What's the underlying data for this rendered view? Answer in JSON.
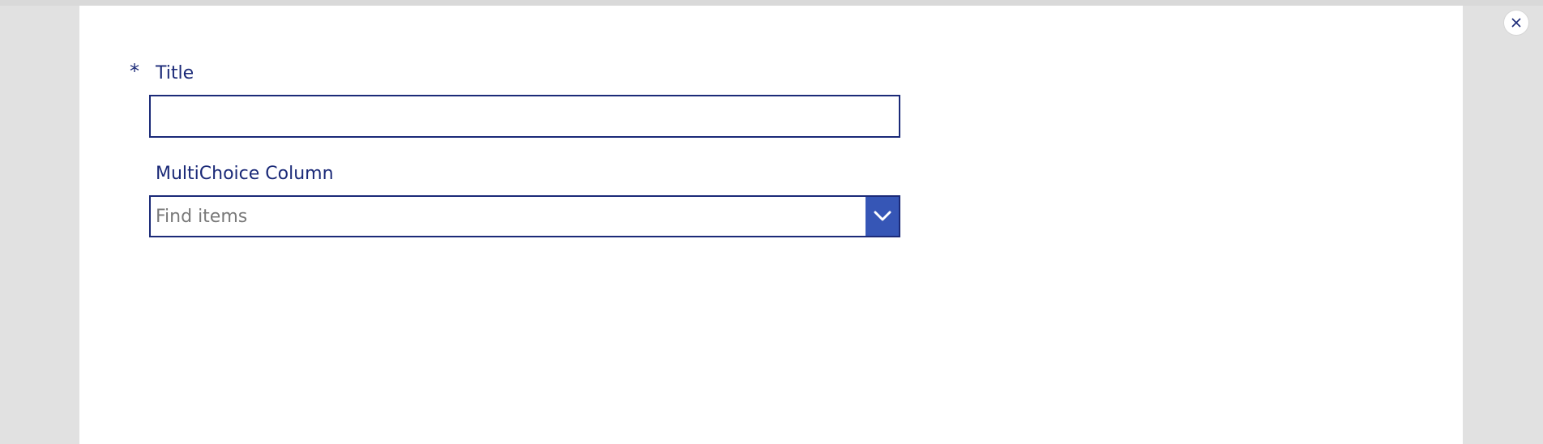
{
  "form": {
    "title_field": {
      "required_marker": "*",
      "label": "Title",
      "value": ""
    },
    "multichoice_field": {
      "label": "MultiChoice Column",
      "placeholder": "Find items"
    }
  },
  "icons": {
    "close": "close-icon",
    "dropdown": "chevron-down-icon"
  },
  "colors": {
    "label": "#1b2a78",
    "accent": "#3656b6",
    "backdrop": "#e1e1e1",
    "panel": "#ffffff"
  }
}
